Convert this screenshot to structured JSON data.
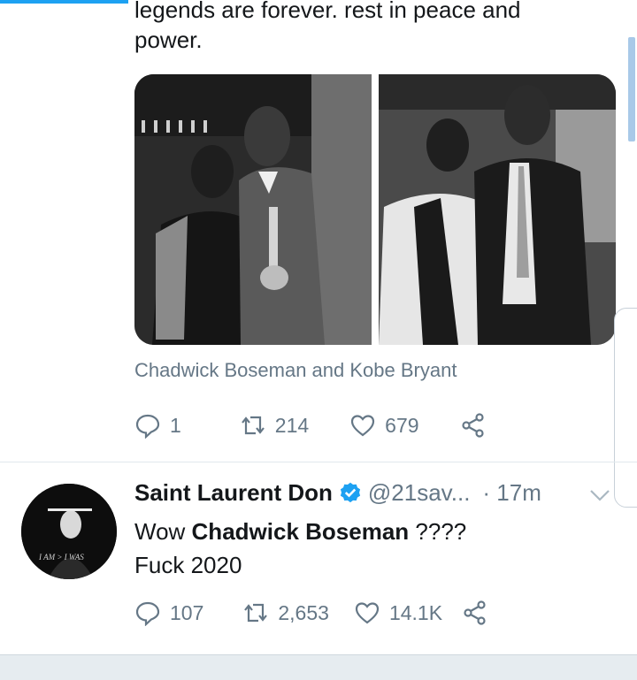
{
  "tweet1": {
    "text": "legends are forever. rest in peace and\npower.",
    "caption": "Chadwick Boseman and Kobe Bryant",
    "actions": {
      "replies": "1",
      "retweets": "214",
      "likes": "679"
    }
  },
  "tweet2": {
    "name": "Saint Laurent Don",
    "handle": "@21sav...",
    "time": "· 17m",
    "text_prefix": "Wow ",
    "text_bold": "Chadwick Boseman",
    "text_suffix": " ????",
    "text_line2": "Fuck 2020",
    "actions": {
      "replies": "107",
      "retweets": "2,653",
      "likes": "14.1K"
    },
    "avatar_text": "I AM > I WAS"
  },
  "colors": {
    "accent": "#1da1f2",
    "muted": "#657786",
    "text": "#14171a"
  },
  "icons": [
    "reply-icon",
    "retweet-icon",
    "like-icon",
    "share-icon",
    "verified-icon",
    "chevron-down-icon"
  ]
}
